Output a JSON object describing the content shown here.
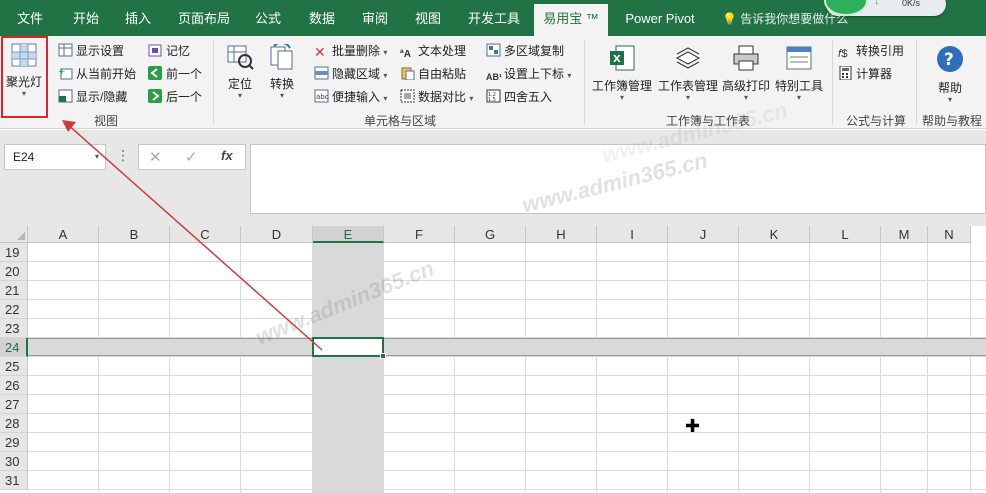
{
  "tabs": [
    {
      "label": "文件"
    },
    {
      "label": "开始"
    },
    {
      "label": "插入"
    },
    {
      "label": "页面布局"
    },
    {
      "label": "公式"
    },
    {
      "label": "数据"
    },
    {
      "label": "审阅"
    },
    {
      "label": "视图"
    },
    {
      "label": "开发工具"
    },
    {
      "label": "易用宝 ™"
    },
    {
      "label": "Power Pivot"
    }
  ],
  "tell_me": "告诉我你想要做什么",
  "network_speed": "0K/s",
  "colors": {
    "accent": "#217346",
    "highlight_box": "#e0232a",
    "arrow": "#d23a3a"
  },
  "ribbon": {
    "view_group": {
      "label": "视图",
      "spotlight": "聚光灯",
      "show_settings": "显示设置",
      "from_current": "从当前开始",
      "show_hide": "显示/隐藏",
      "memory": "记忆",
      "previous": "前一个",
      "next": "后一个"
    },
    "cells_group": {
      "label": "单元格与区域",
      "locate": "定位",
      "convert": "转换",
      "batch_delete": "批量删除",
      "hide_area": "隐藏区域",
      "quick_input": "便捷输入",
      "text_processing": "文本处理",
      "free_paste": "自由粘贴",
      "data_compare": "数据对比",
      "multi_copy": "多区域复制",
      "super_sub": "设置上下标",
      "round": "四舍五入"
    },
    "workbook_group": {
      "label": "工作簿与工作表",
      "workbook_mgmt": "工作簿管理",
      "sheet_mgmt": "工作表管理",
      "advanced_print": "高级打印",
      "special_tools": "特别工具"
    },
    "formula_group": {
      "label": "公式与计算",
      "convert_ref": "转换引用",
      "calculator": "计算器"
    },
    "help_group": {
      "label": "帮助与教程",
      "help": "帮助"
    }
  },
  "formula_bar": {
    "name_box": "E24",
    "cancel_icon": "✕",
    "enter_icon": "✓",
    "fx_label": "fx",
    "formula": ""
  },
  "grid": {
    "columns": [
      "A",
      "B",
      "C",
      "D",
      "E",
      "F",
      "G",
      "H",
      "I",
      "J",
      "K",
      "L",
      "M",
      "N"
    ],
    "rows": [
      "19",
      "20",
      "21",
      "22",
      "23",
      "24",
      "25",
      "26",
      "27",
      "28",
      "29",
      "30",
      "31"
    ],
    "selected_column": "E",
    "selected_row": "24"
  },
  "watermarks": [
    "www.admin365.cn",
    "www.admin365.cn",
    "www.admin365.cn"
  ]
}
